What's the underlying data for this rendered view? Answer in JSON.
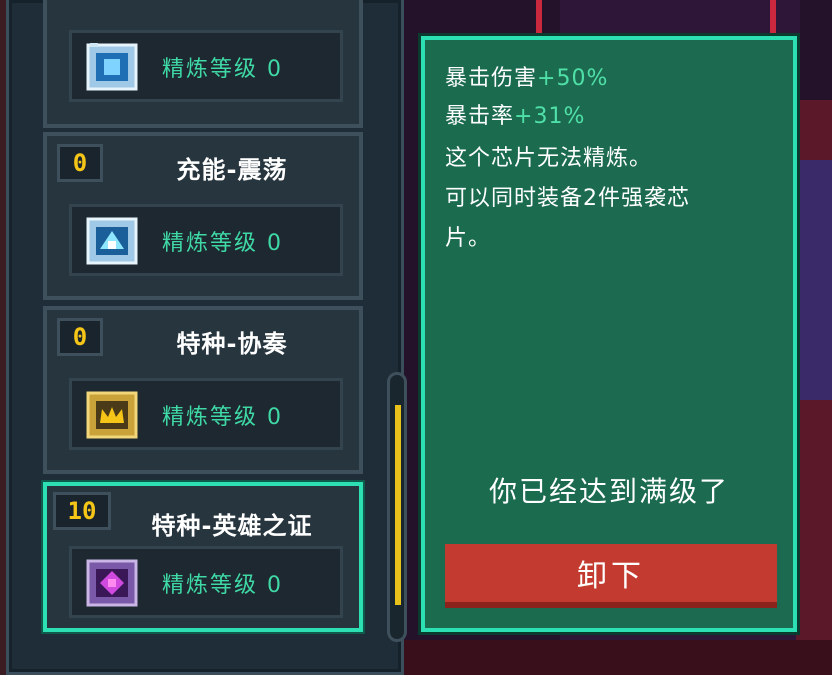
{
  "chips": [
    {
      "name": "",
      "count": "",
      "refine_label": "精炼等级 0",
      "icon": "blue-chip-icon",
      "partial": true
    },
    {
      "name": "充能-震荡",
      "count": "0",
      "refine_label": "精炼等级 0",
      "icon": "shock-chip-icon"
    },
    {
      "name": "特种-协奏",
      "count": "0",
      "refine_label": "精炼等级 0",
      "icon": "gold-crown-chip-icon"
    },
    {
      "name": "特种-英雄之证",
      "count": "10",
      "refine_label": "精炼等级 0",
      "icon": "purple-hero-chip-icon",
      "selected": true
    }
  ],
  "info": {
    "crit_damage_label": "暴击伤害",
    "crit_damage_value": "+50%",
    "crit_rate_label": "暴击率",
    "crit_rate_value": "+31%",
    "desc1": "这个芯片无法精炼。",
    "desc2": "可以同时装备2件强袭芯",
    "desc3": "片。",
    "maxed_text": "你已经达到满级了",
    "unequip_label": "卸下"
  },
  "colors": {
    "accent": "#2de0b4",
    "count_yellow": "#f5c518",
    "refine_green": "#3fd9a6",
    "button_red": "#c33b30",
    "panel_green": "#1a7854"
  }
}
